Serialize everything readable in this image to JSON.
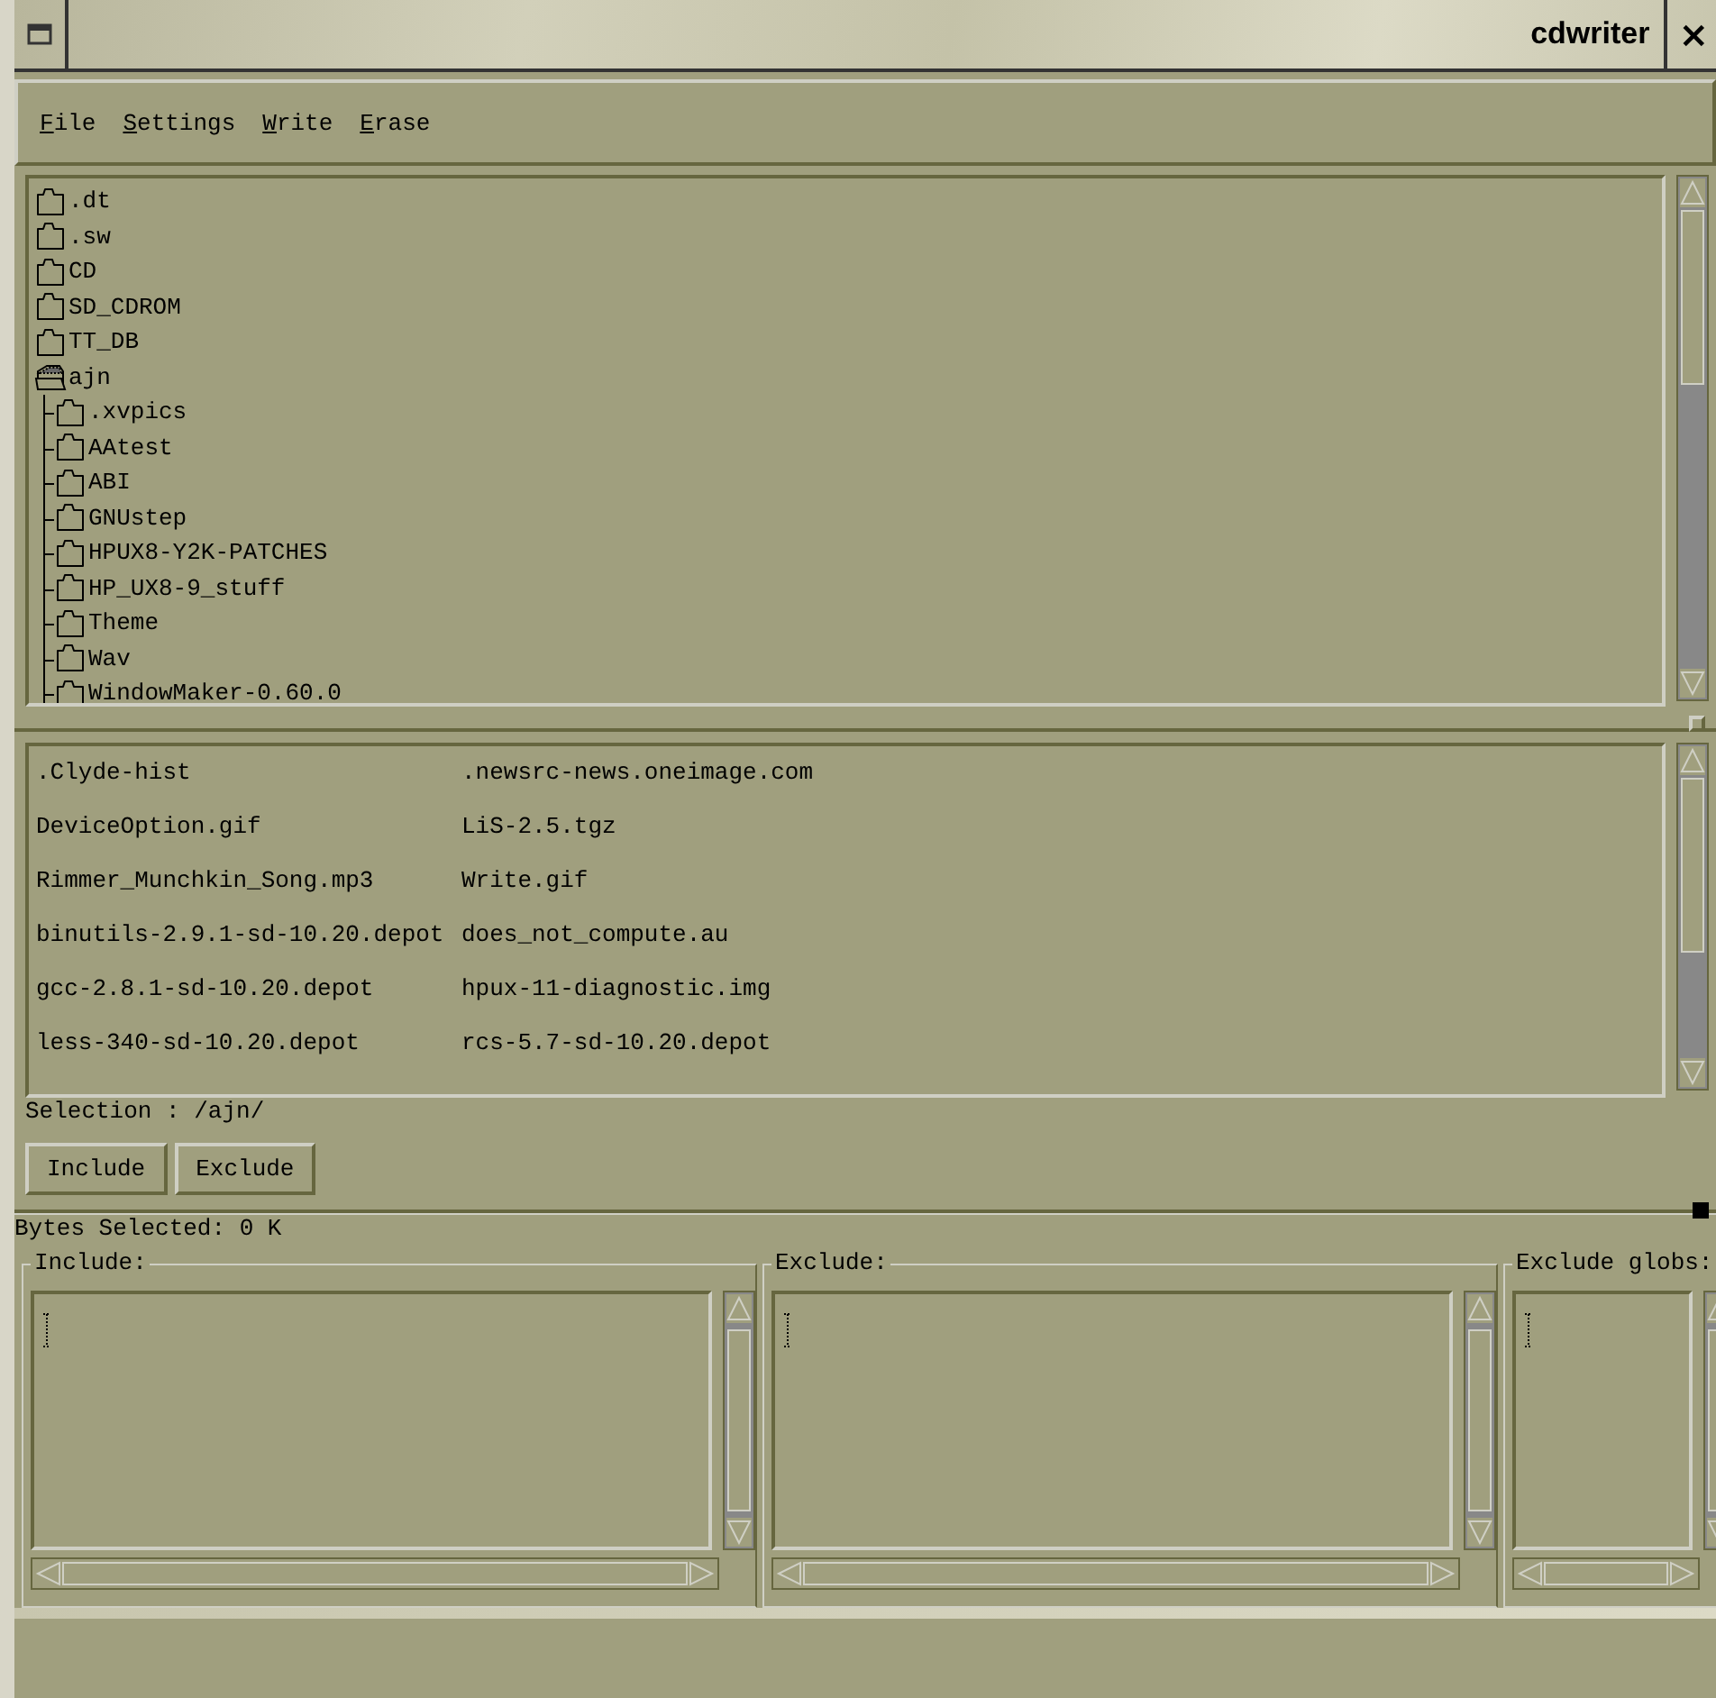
{
  "window": {
    "title": "cdwriter",
    "close": "×"
  },
  "menu": [
    {
      "label": "File"
    },
    {
      "label": "Settings"
    },
    {
      "label": "Write"
    },
    {
      "label": "Erase"
    }
  ],
  "tree": [
    {
      "name": ".dt",
      "expanded": false
    },
    {
      "name": ".sw",
      "expanded": false
    },
    {
      "name": "CD",
      "expanded": false
    },
    {
      "name": "SD_CDROM",
      "expanded": false
    },
    {
      "name": "TT_DB",
      "expanded": false
    },
    {
      "name": "ajn",
      "expanded": true,
      "children": [
        {
          "name": ".xvpics",
          "expanded": false
        },
        {
          "name": "AAtest",
          "expanded": false
        },
        {
          "name": "ABI",
          "expanded": false
        },
        {
          "name": "GNUstep",
          "expanded": false
        },
        {
          "name": "HPUX8-Y2K-PATCHES",
          "expanded": false
        },
        {
          "name": "HP_UX8-9_stuff",
          "expanded": false
        },
        {
          "name": "Theme",
          "expanded": false
        },
        {
          "name": "Wav",
          "expanded": false
        },
        {
          "name": "WindowMaker-0.60.0",
          "expanded": false
        }
      ]
    }
  ],
  "files": [
    [
      ".Clyde-hist",
      ".newsrc-news.oneimage.com"
    ],
    [
      "DeviceOption.gif",
      "LiS-2.5.tgz"
    ],
    [
      "Rimmer_Munchkin_Song.mp3",
      "Write.gif"
    ],
    [
      "binutils-2.9.1-sd-10.20.depot",
      "does_not_compute.au"
    ],
    [
      "gcc-2.8.1-sd-10.20.depot",
      "hpux-11-diagnostic.img"
    ],
    [
      "less-340-sd-10.20.depot",
      "rcs-5.7-sd-10.20.depot"
    ]
  ],
  "selection": "Selection : /ajn/",
  "buttons": [
    "Include",
    "Exclude"
  ],
  "bytes_selected": "Bytes Selected:  0 K",
  "panes": [
    {
      "label": "Include:"
    },
    {
      "label": "Exclude:"
    },
    {
      "label": "Exclude globs:"
    }
  ]
}
